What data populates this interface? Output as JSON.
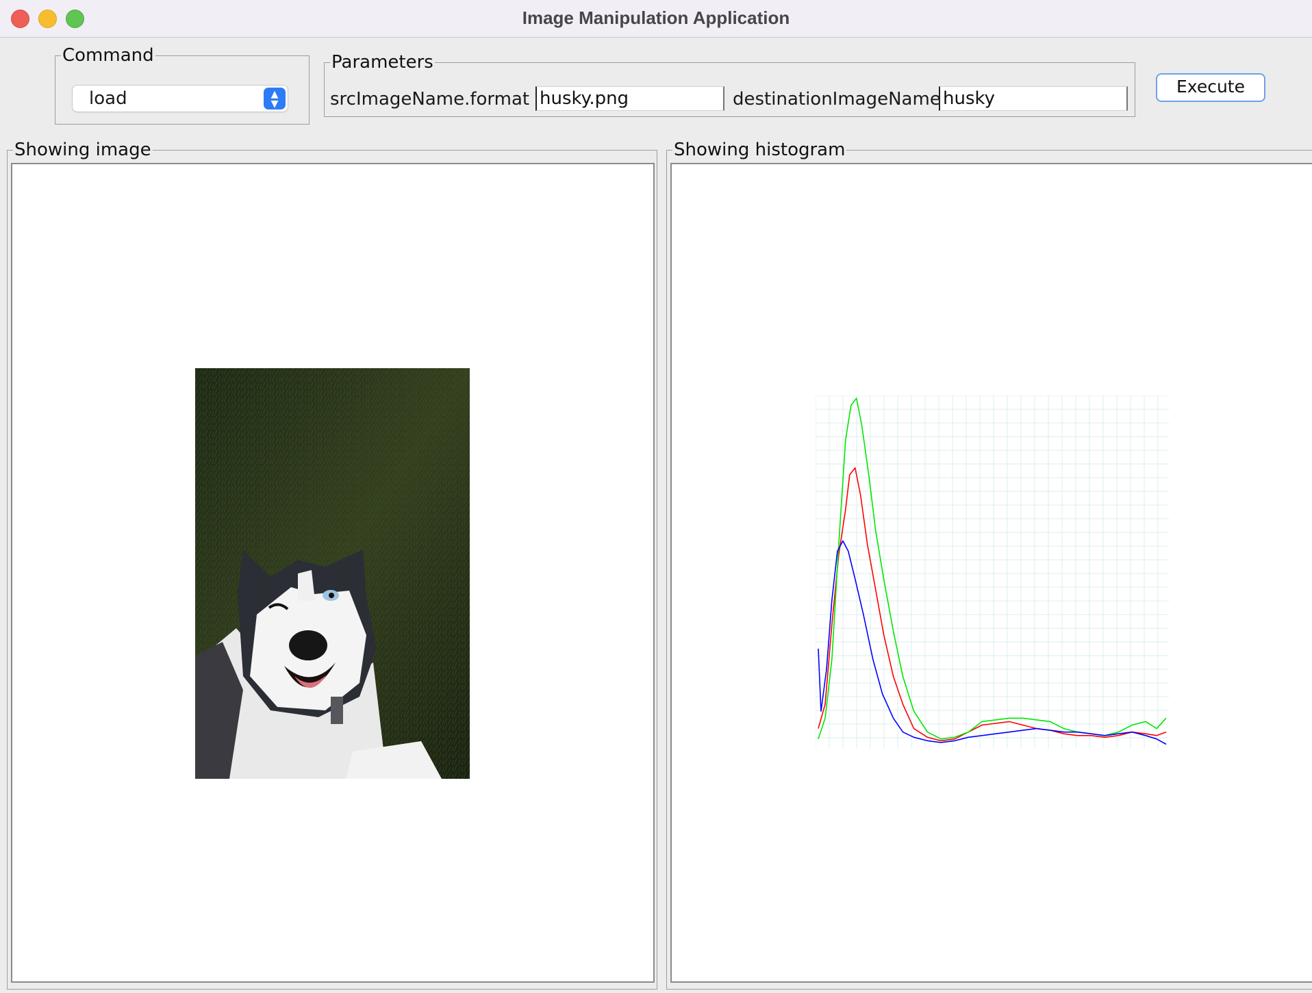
{
  "window": {
    "title": "Image Manipulation Application"
  },
  "command": {
    "legend": "Command",
    "selected": "load"
  },
  "parameters": {
    "legend": "Parameters",
    "src_label": "srcImageName.format",
    "src_value": "husky.png",
    "dest_label": "destinationImageName",
    "dest_value": "husky"
  },
  "execute": {
    "label": "Execute"
  },
  "image_panel": {
    "legend": "Showing image"
  },
  "histogram_panel": {
    "legend": "Showing histogram"
  },
  "colors": {
    "red": "#ff0000",
    "green": "#00e600",
    "blue": "#0000ff",
    "grid": "#dcecee",
    "accent": "#2d7cf6"
  },
  "chart_data": {
    "type": "line",
    "xlim": [
      0,
      255
    ],
    "ylim": [
      0,
      1
    ],
    "grid": true,
    "series": [
      {
        "color": "red",
        "points": [
          [
            0,
            0.05
          ],
          [
            5,
            0.12
          ],
          [
            10,
            0.35
          ],
          [
            15,
            0.55
          ],
          [
            20,
            0.68
          ],
          [
            23,
            0.78
          ],
          [
            27,
            0.8
          ],
          [
            31,
            0.72
          ],
          [
            36,
            0.58
          ],
          [
            42,
            0.45
          ],
          [
            48,
            0.32
          ],
          [
            55,
            0.2
          ],
          [
            62,
            0.12
          ],
          [
            70,
            0.05
          ],
          [
            80,
            0.025
          ],
          [
            90,
            0.015
          ],
          [
            100,
            0.02
          ],
          [
            110,
            0.04
          ],
          [
            120,
            0.06
          ],
          [
            130,
            0.065
          ],
          [
            140,
            0.07
          ],
          [
            150,
            0.06
          ],
          [
            160,
            0.05
          ],
          [
            170,
            0.045
          ],
          [
            180,
            0.035
          ],
          [
            190,
            0.03
          ],
          [
            200,
            0.03
          ],
          [
            210,
            0.025
          ],
          [
            220,
            0.03
          ],
          [
            230,
            0.04
          ],
          [
            240,
            0.035
          ],
          [
            248,
            0.03
          ],
          [
            255,
            0.04
          ]
        ]
      },
      {
        "color": "green",
        "points": [
          [
            0,
            0.02
          ],
          [
            5,
            0.08
          ],
          [
            10,
            0.25
          ],
          [
            15,
            0.58
          ],
          [
            20,
            0.88
          ],
          [
            24,
            0.98
          ],
          [
            28,
            1.0
          ],
          [
            32,
            0.92
          ],
          [
            37,
            0.78
          ],
          [
            42,
            0.62
          ],
          [
            48,
            0.48
          ],
          [
            55,
            0.33
          ],
          [
            62,
            0.2
          ],
          [
            70,
            0.1
          ],
          [
            80,
            0.04
          ],
          [
            90,
            0.02
          ],
          [
            100,
            0.025
          ],
          [
            110,
            0.04
          ],
          [
            120,
            0.07
          ],
          [
            130,
            0.075
          ],
          [
            140,
            0.08
          ],
          [
            150,
            0.08
          ],
          [
            160,
            0.075
          ],
          [
            170,
            0.07
          ],
          [
            180,
            0.05
          ],
          [
            190,
            0.04
          ],
          [
            200,
            0.035
          ],
          [
            210,
            0.03
          ],
          [
            220,
            0.04
          ],
          [
            230,
            0.06
          ],
          [
            240,
            0.07
          ],
          [
            248,
            0.05
          ],
          [
            255,
            0.08
          ]
        ]
      },
      {
        "color": "blue",
        "points": [
          [
            0,
            0.28
          ],
          [
            2,
            0.1
          ],
          [
            6,
            0.22
          ],
          [
            10,
            0.42
          ],
          [
            14,
            0.56
          ],
          [
            18,
            0.59
          ],
          [
            22,
            0.56
          ],
          [
            27,
            0.48
          ],
          [
            33,
            0.38
          ],
          [
            40,
            0.25
          ],
          [
            47,
            0.15
          ],
          [
            55,
            0.08
          ],
          [
            62,
            0.04
          ],
          [
            70,
            0.025
          ],
          [
            80,
            0.015
          ],
          [
            90,
            0.01
          ],
          [
            100,
            0.015
          ],
          [
            110,
            0.025
          ],
          [
            120,
            0.03
          ],
          [
            130,
            0.035
          ],
          [
            140,
            0.04
          ],
          [
            150,
            0.045
          ],
          [
            160,
            0.05
          ],
          [
            170,
            0.045
          ],
          [
            180,
            0.04
          ],
          [
            190,
            0.04
          ],
          [
            200,
            0.035
          ],
          [
            210,
            0.03
          ],
          [
            220,
            0.035
          ],
          [
            230,
            0.04
          ],
          [
            240,
            0.03
          ],
          [
            248,
            0.02
          ],
          [
            255,
            0.005
          ]
        ]
      }
    ]
  }
}
